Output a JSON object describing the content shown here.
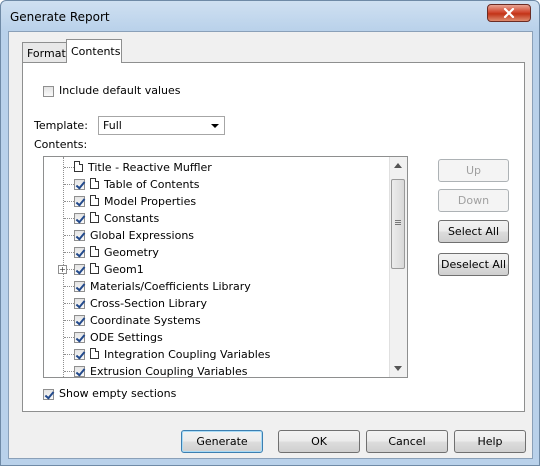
{
  "window": {
    "title": "Generate Report"
  },
  "tabs": [
    {
      "label": "Format",
      "active": false
    },
    {
      "label": "Contents",
      "active": true
    }
  ],
  "include_default_values": {
    "label": "Include default values",
    "checked": false
  },
  "template": {
    "label": "Template:",
    "value": "Full"
  },
  "contents_label": "Contents:",
  "tree": [
    {
      "label": "Title - Reactive Muffler",
      "has_checkbox": false,
      "checked": false,
      "doc_icon": true,
      "expander": false
    },
    {
      "label": "Table of Contents",
      "has_checkbox": true,
      "checked": true,
      "doc_icon": true,
      "expander": false
    },
    {
      "label": "Model Properties",
      "has_checkbox": true,
      "checked": true,
      "doc_icon": true,
      "expander": false
    },
    {
      "label": "Constants",
      "has_checkbox": true,
      "checked": true,
      "doc_icon": true,
      "expander": false
    },
    {
      "label": "Global Expressions",
      "has_checkbox": true,
      "checked": true,
      "doc_icon": false,
      "expander": false
    },
    {
      "label": "Geometry",
      "has_checkbox": true,
      "checked": true,
      "doc_icon": true,
      "expander": false
    },
    {
      "label": "Geom1",
      "has_checkbox": true,
      "checked": true,
      "doc_icon": true,
      "expander": true
    },
    {
      "label": "Materials/Coefficients Library",
      "has_checkbox": true,
      "checked": true,
      "doc_icon": false,
      "expander": false
    },
    {
      "label": "Cross-Section Library",
      "has_checkbox": true,
      "checked": true,
      "doc_icon": false,
      "expander": false
    },
    {
      "label": "Coordinate Systems",
      "has_checkbox": true,
      "checked": true,
      "doc_icon": false,
      "expander": false
    },
    {
      "label": "ODE Settings",
      "has_checkbox": true,
      "checked": true,
      "doc_icon": false,
      "expander": false
    },
    {
      "label": "Integration Coupling Variables",
      "has_checkbox": true,
      "checked": true,
      "doc_icon": true,
      "expander": false
    },
    {
      "label": "Extrusion Coupling Variables",
      "has_checkbox": true,
      "checked": true,
      "doc_icon": false,
      "expander": false
    }
  ],
  "side_buttons": {
    "up": "Up",
    "down": "Down",
    "select_all": "Select All",
    "deselect_all": "Deselect All"
  },
  "show_empty_sections": {
    "label": "Show empty sections",
    "checked": true
  },
  "footer_buttons": {
    "generate": "Generate",
    "ok": "OK",
    "cancel": "Cancel",
    "help": "Help"
  }
}
